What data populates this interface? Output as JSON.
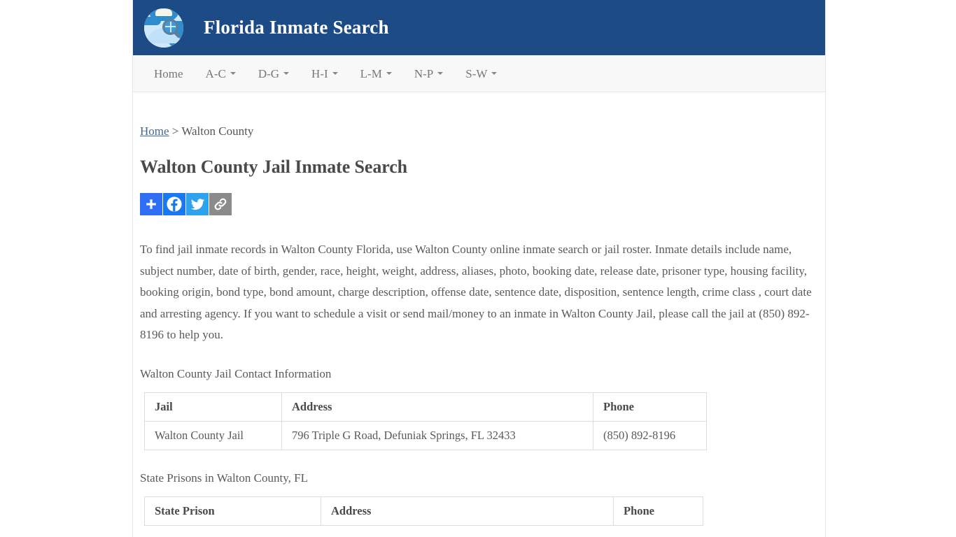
{
  "site": {
    "brand_title": "Florida Inmate Search",
    "logo_icon": "globe-magnifier-icon"
  },
  "nav": {
    "items": [
      {
        "label": "Home",
        "has_caret": false
      },
      {
        "label": "A-C",
        "has_caret": true
      },
      {
        "label": "D-G",
        "has_caret": true
      },
      {
        "label": "H-I",
        "has_caret": true
      },
      {
        "label": "L-M",
        "has_caret": true
      },
      {
        "label": "N-P",
        "has_caret": true
      },
      {
        "label": "S-W",
        "has_caret": true
      }
    ]
  },
  "breadcrumb": {
    "home_label": "Home",
    "separator": " > ",
    "current": "Walton County"
  },
  "page": {
    "title": "Walton County Jail Inmate Search",
    "intro_paragraph": "To find jail inmate records in Walton County Florida, use Walton County online inmate search or jail roster. Inmate details include name, subject number, date of birth, gender, race, height, weight, address, aliases, photo, booking date, release date, prisoner type, housing facility, booking origin, bond type, bond amount, charge description, offense date, sentence date, disposition, sentence length, crime class , court date and arresting agency. If you want to schedule a visit or send mail/money to an inmate in Walton County Jail, please call the jail at (850) 892-8196 to help you."
  },
  "share": {
    "buttons": [
      {
        "name": "addthis-share-button",
        "icon": "plus-icon",
        "color": "#2e6ff5"
      },
      {
        "name": "facebook-share-button",
        "icon": "facebook-icon",
        "color": "#1877f2"
      },
      {
        "name": "twitter-share-button",
        "icon": "twitter-icon",
        "color": "#2fa2ee"
      },
      {
        "name": "copy-link-button",
        "icon": "link-icon",
        "color": "#8b8b8b"
      }
    ]
  },
  "contact_section": {
    "heading": "Walton County Jail Contact Information",
    "columns": [
      "Jail",
      "Address",
      "Phone"
    ],
    "rows": [
      {
        "jail": "Walton County Jail",
        "address": "796 Triple G Road, Defuniak Springs, FL 32433",
        "phone": "(850) 892-8196"
      }
    ]
  },
  "prison_section": {
    "heading": "State Prisons in Walton County, FL",
    "columns": [
      "State Prison",
      "Address",
      "Phone"
    ]
  },
  "colors": {
    "header_blue": "#1c4b85",
    "navbar_bg": "#f8f8f8",
    "body_text": "#5a5a5a",
    "link_blue": "#45688e",
    "table_border": "#dddddd"
  }
}
